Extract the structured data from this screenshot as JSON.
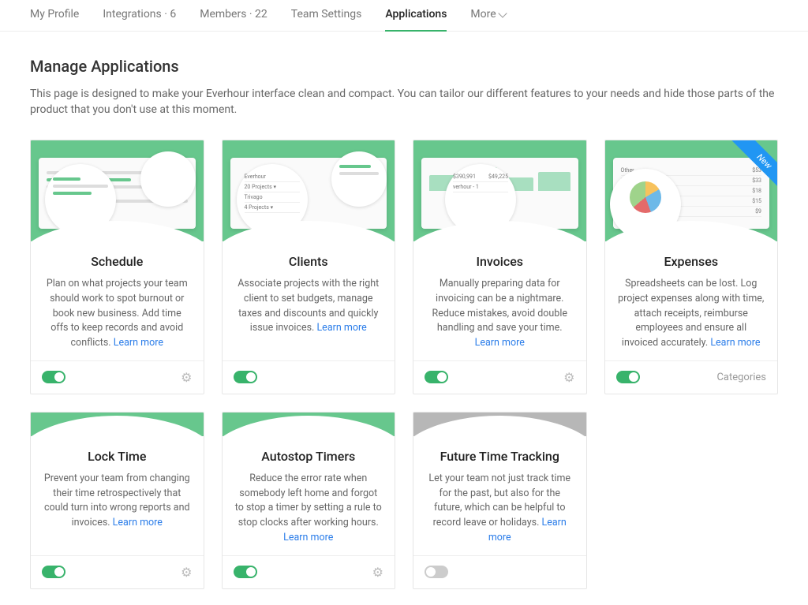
{
  "tabs": {
    "profile": "My Profile",
    "integrations": "Integrations · 6",
    "members": "Members · 22",
    "team": "Team Settings",
    "applications": "Applications",
    "more": "More"
  },
  "page": {
    "title": "Manage Applications",
    "subtitle": "This page is designed to make your Everhour interface clean and compact. You can tailor our different features to your needs and hide those parts of the product that you don't use at this moment."
  },
  "learn_more": "Learn more",
  "categories_label": "Categories",
  "new_badge": "New",
  "cards": {
    "schedule": {
      "title": "Schedule",
      "desc": "Plan on what projects your team should work to spot burnout or book new business. Add time offs to keep records and avoid conflicts. "
    },
    "clients": {
      "title": "Clients",
      "desc": "Associate projects with the right client to set budgets, manage taxes and discounts and quickly issue invoices. "
    },
    "invoices": {
      "title": "Invoices",
      "desc": "Manually preparing data for invoicing can be a nightmare. Reduce mistakes, avoid double handling and save your time. "
    },
    "expenses": {
      "title": "Expenses",
      "desc": "Spreadsheets can be lost. Log project expenses along with time, attach receipts, reimburse employees and ensure all invoiced accurately. "
    },
    "locktime": {
      "title": "Lock Time",
      "desc": "Prevent your team from changing their time retrospectively that could turn into wrong reports and invoices. "
    },
    "autostop": {
      "title": "Autostop Timers",
      "desc": "Reduce the error rate when somebody left home and forgot to stop a timer by setting a rule to stop clocks after working hours. "
    },
    "future": {
      "title": "Future Time Tracking",
      "desc": "Let your team not just track time for the past, but also for the future, which can be helpful to record leave or holidays. "
    }
  }
}
